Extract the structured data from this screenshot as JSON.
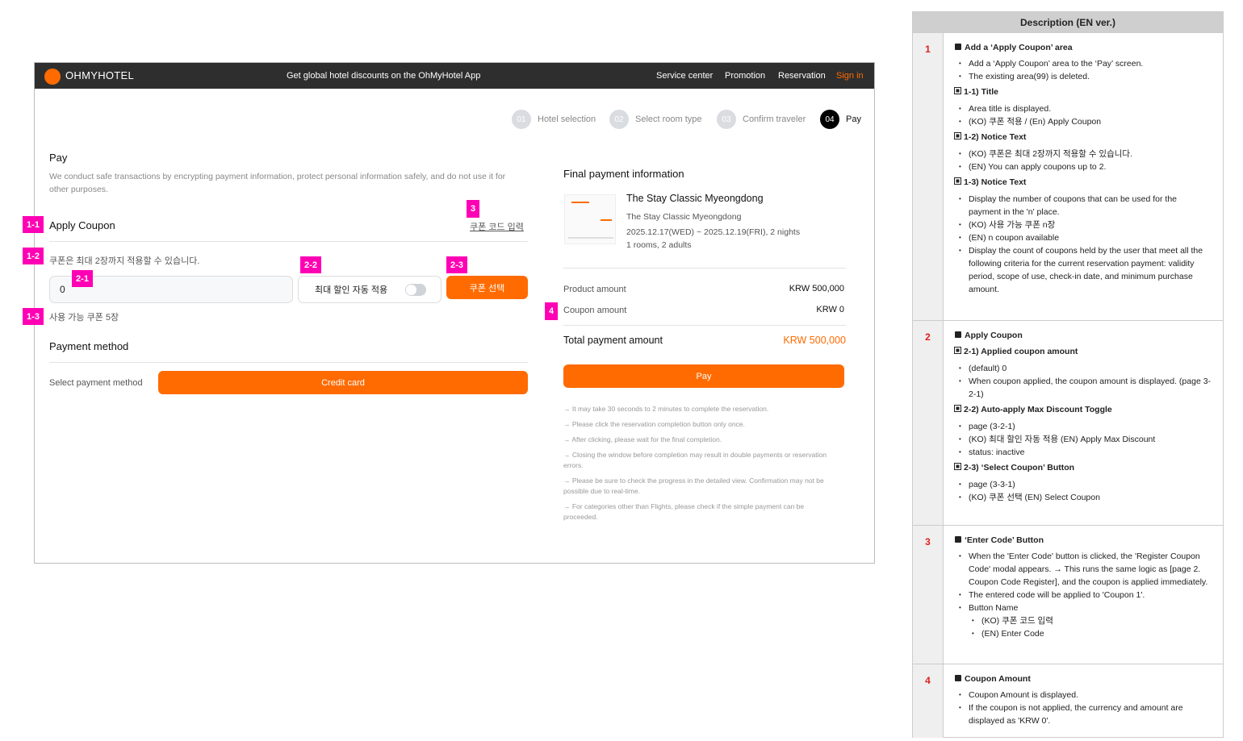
{
  "header": {
    "logo": "OHMYHOTEL",
    "promo": "Get global hotel discounts on the OhMyHotel App",
    "nav": [
      "Service center",
      "Promotion",
      "Reservation"
    ],
    "sign_in": "Sign in"
  },
  "steps": [
    {
      "num": "01",
      "label": "Hotel selection"
    },
    {
      "num": "02",
      "label": "Select room type"
    },
    {
      "num": "03",
      "label": "Confirm traveler"
    },
    {
      "num": "04",
      "label": "Pay"
    }
  ],
  "pay": {
    "title": "Pay",
    "desc": "We conduct safe transactions by encrypting payment information, protect personal information safely, and do not use it for other purposes."
  },
  "coupon": {
    "title": "Apply Coupon",
    "enter_code": "쿠폰 코드 입력",
    "notice": "쿠폰은 최대 2장까지 적용할 수 있습니다.",
    "amount_value": "0",
    "auto_apply_label": "최대 할인 자동 적용",
    "auto_apply_on": false,
    "select_button": "쿠폰 선택",
    "available": "사용 가능 쿠폰 5장"
  },
  "payment_method": {
    "title": "Payment method",
    "label": "Select payment method",
    "option": "Credit card"
  },
  "annotations": {
    "a11": "1-1",
    "a12": "1-2",
    "a13": "1-3",
    "a21": "2-1",
    "a22": "2-2",
    "a23": "2-3",
    "a3": "3",
    "a4": "4"
  },
  "summary": {
    "title": "Final payment information",
    "hotel_name": "The Stay Classic Myeongdong",
    "hotel_sub": "The Stay Classic Myeongdong",
    "dates": "2025.12.17(WED) ~ 2025.12.19(FRI), 2 nights",
    "guests": "1 rooms, 2 adults",
    "product_label": "Product amount",
    "product_value": "KRW 500,000",
    "coupon_label": "Coupon amount",
    "coupon_value": "KRW 0",
    "total_label": "Total payment amount",
    "total_value": "KRW 500,000",
    "pay_button": "Pay",
    "notes": [
      "→ It may take 30 seconds to 2 minutes to complete the reservation.",
      "→ Please click the reservation completion button only once.",
      "→ After clicking, please wait for the final completion.",
      "→ Closing the window before completion may result in double payments or reservation errors.",
      "→ Please be sure to check the progress in the detailed view. Confirmation may not be possible due to real-time.",
      "→ For categories other than Flights, please check if the simple payment can be proceeded."
    ]
  },
  "description": {
    "title": "Description (EN ver.)",
    "sections": [
      {
        "num": "1",
        "items": [
          {
            "t": "h",
            "text": "Add a ‘Apply Coupon’ area"
          },
          {
            "t": "b",
            "text": "Add a ‘Apply Coupon’ area to the ‘Pay’ screen."
          },
          {
            "t": "b",
            "text": "The existing area(99) is deleted."
          },
          {
            "t": "s",
            "text": "1-1) Title"
          },
          {
            "t": "b",
            "text": "Area title is displayed."
          },
          {
            "t": "b",
            "text": "(KO) 쿠폰 적용 / (En) Apply Coupon"
          },
          {
            "t": "s",
            "text": "1-2) Notice Text"
          },
          {
            "t": "b",
            "text": "(KO) 쿠폰은 최대 2장까지 적용할 수 있습니다."
          },
          {
            "t": "b",
            "text": "(EN) You can apply coupons up to 2."
          },
          {
            "t": "s",
            "text": "1-3) Notice Text"
          },
          {
            "t": "b",
            "text": "Display the number of coupons that can be used for the payment in the 'n' place."
          },
          {
            "t": "b",
            "text": "(KO) 사용 가능 쿠폰 n장"
          },
          {
            "t": "b",
            "text": "(EN) n coupon available"
          },
          {
            "t": "b",
            "text": "Display the count of coupons held by the user that meet all the following criteria for the current reservation payment: validity period, scope of use, check-in date, and minimum purchase amount."
          }
        ]
      },
      {
        "num": "2",
        "items": [
          {
            "t": "h",
            "text": "Apply Coupon"
          },
          {
            "t": "s",
            "text": "2-1) Applied coupon amount"
          },
          {
            "t": "b",
            "text": "(default) 0"
          },
          {
            "t": "b",
            "text": "When coupon applied, the coupon amount is displayed. (page 3-2-1)"
          },
          {
            "t": "s",
            "text": "2-2) Auto-apply Max Discount Toggle"
          },
          {
            "t": "b",
            "text": "page (3-2-1)"
          },
          {
            "t": "b",
            "text": "(KO) 최대 할인 자동 적용 (EN) Apply Max Discount"
          },
          {
            "t": "b",
            "text": "status: inactive"
          },
          {
            "t": "s",
            "text": "2-3) ‘Select Coupon’ Button"
          },
          {
            "t": "b",
            "text": "page (3-3-1)"
          },
          {
            "t": "b",
            "text": "(KO) 쿠폰 선택 (EN) Select Coupon"
          }
        ]
      },
      {
        "num": "3",
        "items": [
          {
            "t": "h",
            "text": "‘Enter Code’ Button"
          },
          {
            "t": "b",
            "text": "When the 'Enter Code' button is clicked, the 'Register Coupon Code' modal appears. → This runs the same logic as [page 2. Coupon Code Register], and the coupon is applied immediately."
          },
          {
            "t": "b",
            "text": "The entered code will be applied to 'Coupon 1'."
          },
          {
            "t": "b",
            "text": "Button Name"
          },
          {
            "t": "bb",
            "text": "(KO) 쿠폰 코드 입력"
          },
          {
            "t": "bb",
            "text": "(EN) Enter Code"
          }
        ]
      },
      {
        "num": "4",
        "items": [
          {
            "t": "h",
            "text": "Coupon Amount"
          },
          {
            "t": "b",
            "text": "Coupon Amount is displayed."
          },
          {
            "t": "b",
            "text": "If the coupon is not applied, the currency and amount are displayed as 'KRW 0'."
          }
        ]
      }
    ]
  },
  "colors": {
    "accent": "#ff6b00",
    "annotation": "#ff00b4",
    "header_bg": "#2e2e2e"
  }
}
